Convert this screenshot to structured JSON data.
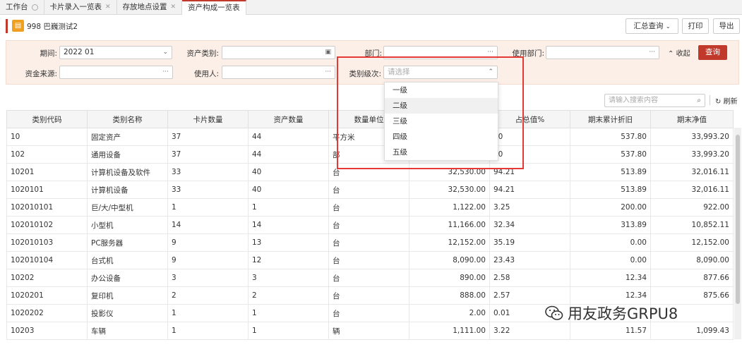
{
  "tabs": [
    {
      "label": "工作台",
      "active": false,
      "icon": "circle-close-icon"
    },
    {
      "label": "卡片录入一览表",
      "active": false,
      "icon": "close-icon"
    },
    {
      "label": "存放地点设置",
      "active": false,
      "icon": "close-icon"
    },
    {
      "label": "资产构成一览表",
      "active": true,
      "icon": "close-icon"
    }
  ],
  "header": {
    "title": "998 巴巍测试2",
    "summary_btn": "汇总查询",
    "print_btn": "打印",
    "export_btn": "导出"
  },
  "filters": {
    "period_label": "期间:",
    "period_value": "2022 01",
    "asset_category_label": "资产类别:",
    "asset_category_value": "",
    "dept_label": "部门:",
    "dept_value": "",
    "use_dept_label": "使用部门:",
    "use_dept_value": "",
    "fund_source_label": "资金来源:",
    "fund_source_value": "",
    "user_label": "使用人:",
    "user_value": "",
    "level_label": "类别级次:",
    "level_placeholder": "请选择",
    "collapse_label": "收起",
    "query_btn": "查询"
  },
  "toolbar": {
    "search_placeholder": "请输入搜索内容",
    "refresh_label": "刷新"
  },
  "table": {
    "columns": [
      "类别代码",
      "类别名称",
      "卡片数量",
      "资产数量",
      "数量单位",
      "",
      "占总值%",
      "期末累计折旧",
      "期末净值"
    ],
    "rows": [
      [
        "10",
        "固定资产",
        "37",
        "44",
        "平方米",
        "",
        "00",
        "537.80",
        "33,993.20"
      ],
      [
        "102",
        "通用设备",
        "37",
        "44",
        "部",
        "",
        "00",
        "537.80",
        "33,993.20"
      ],
      [
        "10201",
        "计算机设备及软件",
        "33",
        "40",
        "台",
        "32,530.00",
        "94.21",
        "513.89",
        "32,016.11"
      ],
      [
        "1020101",
        "计算机设备",
        "33",
        "40",
        "台",
        "32,530.00",
        "94.21",
        "513.89",
        "32,016.11"
      ],
      [
        "102010101",
        "巨/大/中型机",
        "1",
        "1",
        "台",
        "1,122.00",
        "3.25",
        "200.00",
        "922.00"
      ],
      [
        "102010102",
        "小型机",
        "14",
        "14",
        "台",
        "11,166.00",
        "32.34",
        "313.89",
        "10,852.11"
      ],
      [
        "102010103",
        "PC服务器",
        "9",
        "13",
        "台",
        "12,152.00",
        "35.19",
        "0.00",
        "12,152.00"
      ],
      [
        "102010104",
        "台式机",
        "9",
        "12",
        "台",
        "8,090.00",
        "23.43",
        "0.00",
        "8,090.00"
      ],
      [
        "10202",
        "办公设备",
        "3",
        "3",
        "台",
        "890.00",
        "2.58",
        "12.34",
        "877.66"
      ],
      [
        "1020201",
        "复印机",
        "2",
        "2",
        "台",
        "888.00",
        "2.57",
        "12.34",
        "875.66"
      ],
      [
        "1020202",
        "投影仪",
        "1",
        "1",
        "台",
        "2.00",
        "0.01",
        "",
        ""
      ],
      [
        "10203",
        "车辆",
        "1",
        "1",
        "辆",
        "1,111.00",
        "3.22",
        "11.57",
        "1,099.43"
      ]
    ]
  },
  "dropdown": {
    "options": [
      "一级",
      "二级",
      "三级",
      "四级",
      "五级"
    ],
    "highlighted": "二级"
  },
  "watermark": {
    "text": "用友政务GRPU8"
  },
  "colors": {
    "accent": "#c0392b",
    "highlight_box": "#e53935",
    "filter_bg": "#fcefe8"
  }
}
